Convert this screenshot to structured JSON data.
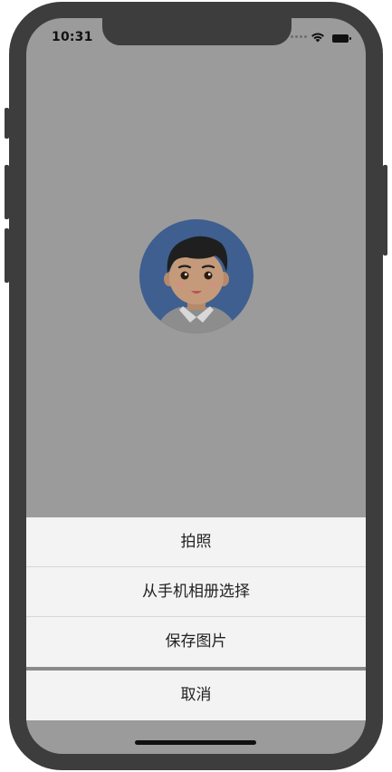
{
  "status_bar": {
    "time": "10:31"
  },
  "profile": {
    "avatar_icon": "man-avatar-icon"
  },
  "action_sheet": {
    "items": [
      {
        "label": "拍照"
      },
      {
        "label": "从手机相册选择"
      },
      {
        "label": "保存图片"
      }
    ],
    "cancel_label": "取消"
  },
  "colors": {
    "overlay": "#9b9b9b",
    "sheet_bg": "#f3f3f3",
    "avatar_bg": "#3e5f8f",
    "frame": "#3d3d3d"
  }
}
